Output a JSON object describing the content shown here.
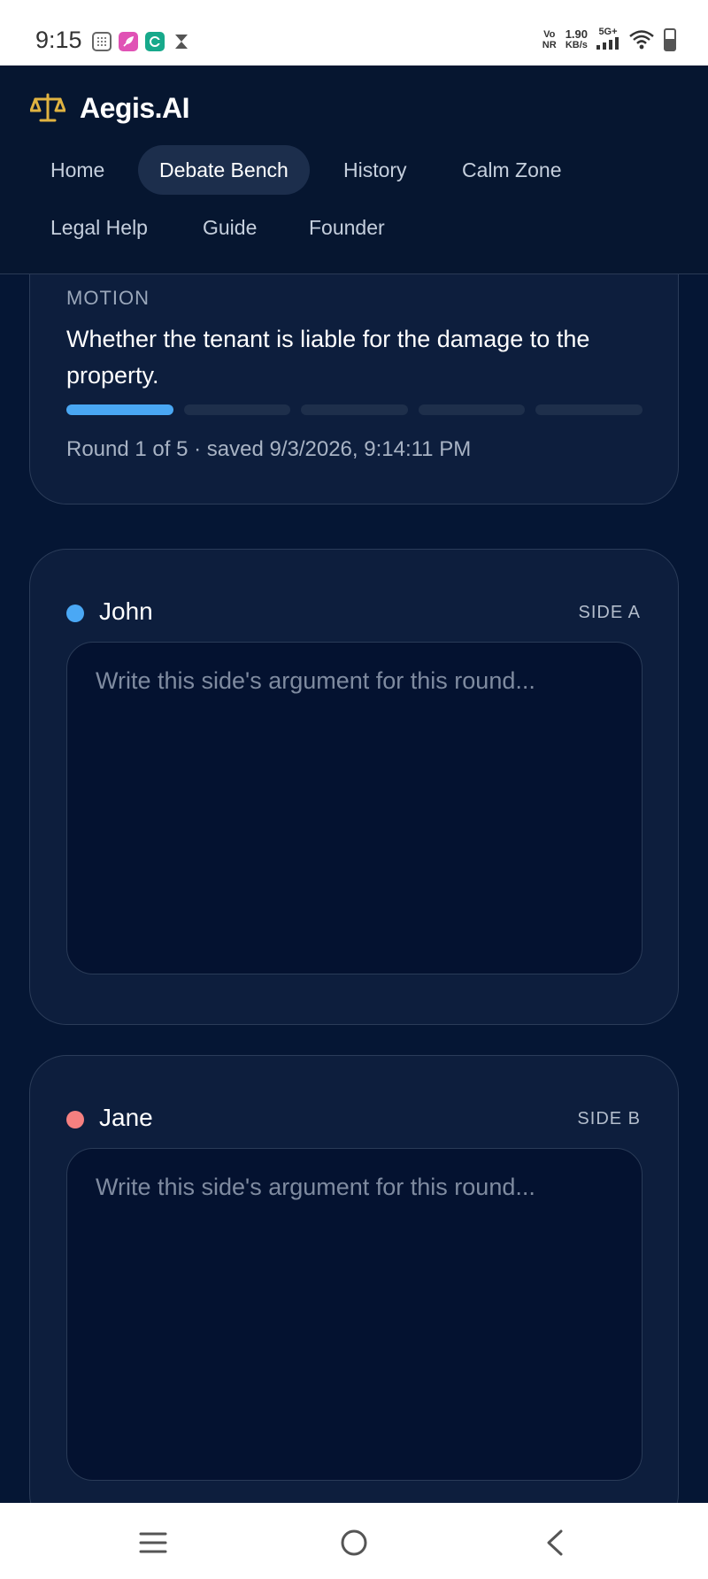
{
  "status_bar": {
    "time": "9:15",
    "network_top": "Vo",
    "network_bottom": "NR",
    "speed_value": "1.90",
    "speed_unit": "KB/s",
    "signal_label": "5G+"
  },
  "header": {
    "brand": "Aegis.AI",
    "nav": [
      {
        "label": "Home"
      },
      {
        "label": "Debate Bench",
        "active": true
      },
      {
        "label": "History"
      },
      {
        "label": "Calm Zone"
      },
      {
        "label": "Legal Help"
      },
      {
        "label": "Guide"
      },
      {
        "label": "Founder"
      }
    ]
  },
  "motion": {
    "label": "MOTION",
    "text": "Whether the tenant is liable for the damage to the property.",
    "round_current": 1,
    "round_total": 5,
    "round_info": "Round 1 of 5 · saved 9/3/2026, 9:14:11 PM"
  },
  "sides": [
    {
      "name": "John",
      "tag": "SIDE A",
      "color": "#4aa8f5",
      "placeholder": "Write this side's argument for this round..."
    },
    {
      "name": "Jane",
      "tag": "SIDE B",
      "color": "#f58080",
      "placeholder": "Write this side's argument for this round..."
    }
  ],
  "colors": {
    "background": "#051634",
    "accent_blue": "#49a7f3",
    "logo_gold": "#e0b341"
  },
  "icons": {
    "logo": "scales-icon",
    "menu": "menu-icon",
    "home": "home-circle-icon",
    "back": "back-chevron-icon"
  }
}
